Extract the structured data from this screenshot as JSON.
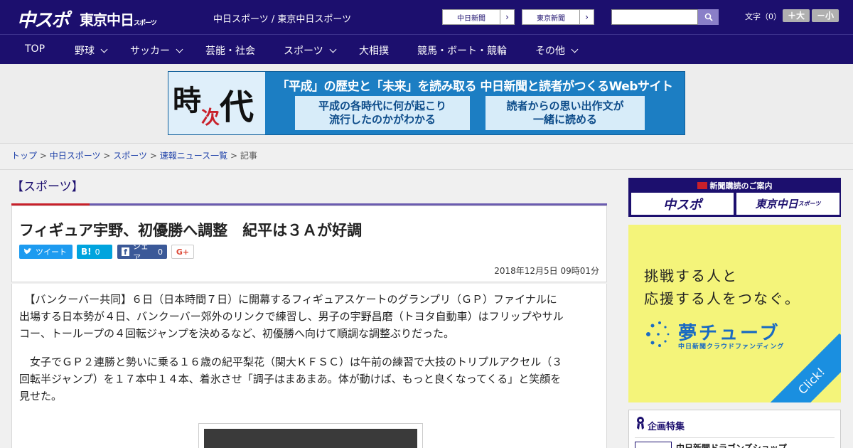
{
  "header": {
    "logo_main": "中スポ",
    "logo_tokyo": "東京中日",
    "logo_tokyo_suffix": "スポーツ",
    "site_links": "中日スポーツ / 東京中日スポーツ",
    "btn_chunichi": "中日新聞",
    "btn_tokyo": "東京新聞",
    "search_placeholder": "",
    "font_label": "文字（0）",
    "font_bigger": "＋大",
    "font_smaller": "－小"
  },
  "nav": {
    "items": [
      {
        "label": "TOP"
      },
      {
        "label": "野球"
      },
      {
        "label": "サッカー"
      },
      {
        "label": "芸能・社会"
      },
      {
        "label": "スポーツ"
      },
      {
        "label": "大相撲"
      },
      {
        "label": "競馬・ボート・競輪"
      },
      {
        "label": "その他"
      }
    ]
  },
  "banner": {
    "char1": "時",
    "char2": "次",
    "char3": "代",
    "headline": "「平成」の歴史と「未来」を読み取る 中日新聞と読者がつくるWebサイト",
    "box1_line1": "平成の各時代に何が起こり",
    "box1_line2": "流行したのかがわかる",
    "box2_line1": "読者からの思い出作文が",
    "box2_line2": "一緒に読める"
  },
  "breadcrumb": {
    "items": [
      "トップ",
      "中日スポーツ",
      "スポーツ",
      "速報ニュース一覧"
    ],
    "current": "記事",
    "separator": ">"
  },
  "section": {
    "title": "【スポーツ】"
  },
  "article": {
    "title": "フィギュア宇野、初優勝へ調整　紀平は３Ａが好調",
    "tweet_label": "ツイート",
    "hatena_label": "B!",
    "hatena_count": "0",
    "fb_label": "シェア",
    "fb_count": "0",
    "gplus_label": "G+",
    "date": "2018年12月5日 09時01分",
    "para1_line1": "　【バンクーバー共同】６日（日本時間７日）に開幕するフィギュアスケートのグランプリ（ＧＰ）ファイナルに",
    "para1_line2": "出場する日本勢が４日、バンクーバー郊外のリンクで練習し、男子の宇野昌磨（トヨタ自動車）はフリップやサル",
    "para1_line3": "コー、トーループの４回転ジャンプを決めるなど、初優勝へ向けて順調な調整ぶりだった。",
    "para2_line1": "　女子でＧＰ２連勝と勢いに乗る１６歳の紀平梨花（関大ＫＦＳＣ）は午前の練習で大技のトリプルアクセル（３",
    "para2_line2": "回転半ジャンプ）を１７本中１４本、着氷させ「調子はまあまあ。体が動けば、もっと良くなってくる」と笑顔を",
    "para2_line3": "見せた。"
  },
  "sidebar": {
    "subscribe_caption": "新聞購読のご案内",
    "sub_logo1": "中スポ",
    "sub_logo2": "東京中日",
    "sub_logo2_suffix": "スポーツ",
    "ad_line1": "挑戦する人と",
    "ad_line2": "応援する人をつなぐ。",
    "ad_brand": "夢チューブ",
    "ad_brand_sub": "中日新聞クラウドファンディング",
    "ad_click": "Click!",
    "feature_title": "企画特集",
    "feature_item1": "中日新聞ドラゴンズショップ"
  },
  "colors": {
    "brand_navy": "#1c0f6e",
    "accent_purple": "#6b5cb0",
    "accent_red": "#c8202a",
    "twitter": "#1d9bf0",
    "hatena": "#00a4de",
    "facebook": "#3b5998"
  }
}
